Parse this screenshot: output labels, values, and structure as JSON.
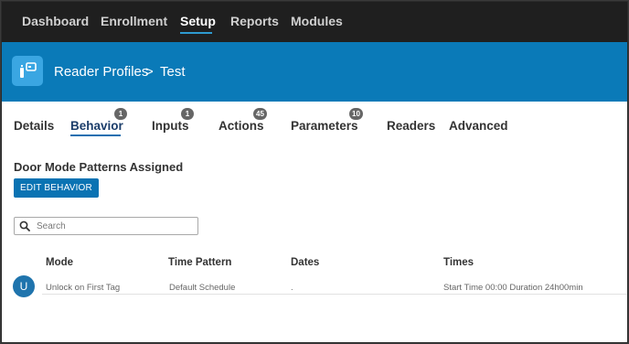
{
  "nav": {
    "items": [
      "Dashboard",
      "Enrollment",
      "Setup",
      "Reports",
      "Modules"
    ],
    "active": "Setup"
  },
  "header": {
    "section": "Reader Profiles",
    "separator": ">",
    "current": "Test"
  },
  "tabs": [
    {
      "label": "Details"
    },
    {
      "label": "Behavior",
      "badge": "1",
      "active": true
    },
    {
      "label": "Inputs",
      "badge": "1"
    },
    {
      "label": "Actions",
      "badge": "45"
    },
    {
      "label": "Parameters",
      "badge": "10"
    },
    {
      "label": "Readers"
    },
    {
      "label": "Advanced"
    }
  ],
  "behavior": {
    "title": "Door Mode Patterns Assigned",
    "edit_button": "EDIT BEHAVIOR",
    "search_placeholder": "Search"
  },
  "table": {
    "columns": [
      "Mode",
      "Time Pattern",
      "Dates",
      "Times"
    ],
    "rows": [
      {
        "avatar": "U",
        "mode": "Unlock on First Tag",
        "time_pattern": "Default Schedule",
        "dates": ".",
        "times": "Start Time 00:00 Duration 24h00min"
      }
    ]
  },
  "colors": {
    "accent": "#0a7ab8",
    "nav_bg": "#1f1f1f",
    "button": "#0a73b3"
  },
  "icons": {
    "app": "reader-profile-icon",
    "search": "search-icon"
  }
}
